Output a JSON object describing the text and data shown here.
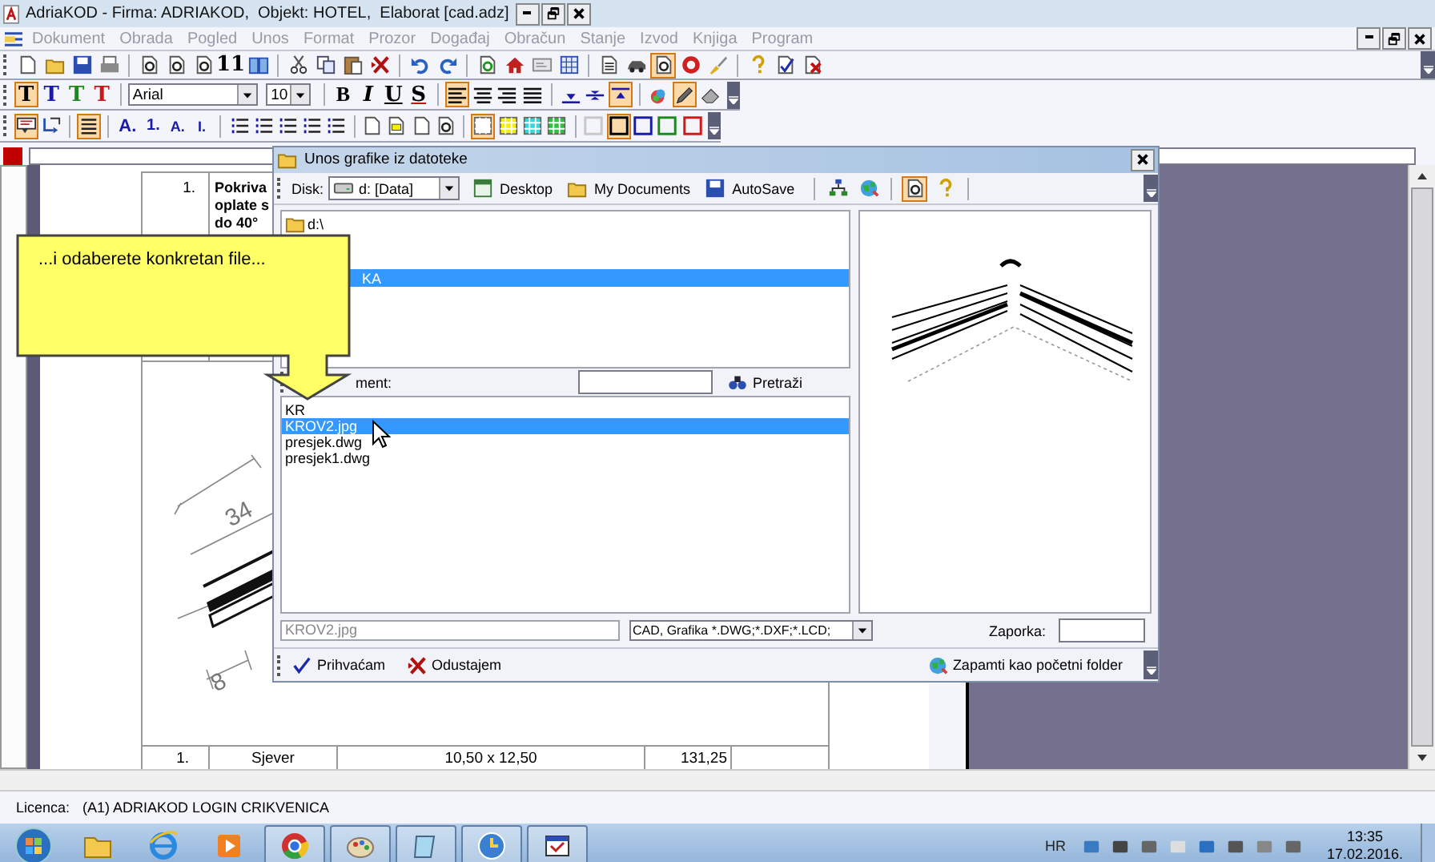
{
  "window": {
    "title": "AdriaKOD - Firma: ADRIAKOD,  Objekt: HOTEL,  Elaborat [cad.adz]"
  },
  "menu": [
    {
      "label": "Dokument",
      "disabled": true
    },
    {
      "label": "Obrada",
      "disabled": true
    },
    {
      "label": "Pogled",
      "disabled": true
    },
    {
      "label": "Unos",
      "disabled": true
    },
    {
      "label": "Format",
      "disabled": true
    },
    {
      "label": "Prozor",
      "disabled": true
    },
    {
      "label": "Događaj",
      "disabled": true
    },
    {
      "label": "Obračun",
      "disabled": true
    },
    {
      "label": "Stanje",
      "disabled": true
    },
    {
      "label": "Izvod",
      "disabled": true
    },
    {
      "label": "Knjiga",
      "disabled": true
    },
    {
      "label": "Program",
      "disabled": true
    }
  ],
  "toolbar_1": [
    [
      {
        "kind": "icon",
        "pressed": false
      },
      {
        "kind": "icon",
        "pressed": false
      },
      {
        "kind": "icon",
        "pressed": false
      },
      {
        "kind": "icon",
        "pressed": false
      }
    ],
    [
      {
        "kind": "icon",
        "pressed": false
      },
      {
        "kind": "icon",
        "pressed": false
      },
      {
        "kind": "icon",
        "pressed": false
      },
      {
        "kind": "text",
        "label": "11",
        "pressed": false
      },
      {
        "kind": "icon",
        "pressed": false
      }
    ],
    [
      {
        "kind": "icon",
        "pressed": false
      },
      {
        "kind": "icon",
        "pressed": false
      },
      {
        "kind": "icon",
        "pressed": false
      },
      {
        "kind": "icon",
        "pressed": false
      }
    ],
    [
      {
        "kind": "icon",
        "pressed": false
      },
      {
        "kind": "icon",
        "pressed": false
      }
    ],
    [
      {
        "kind": "icon",
        "pressed": false
      },
      {
        "kind": "icon",
        "pressed": false
      },
      {
        "kind": "icon",
        "pressed": false
      },
      {
        "kind": "icon",
        "pressed": false
      }
    ],
    [
      {
        "kind": "icon",
        "pressed": false
      },
      {
        "kind": "icon",
        "pressed": false
      },
      {
        "kind": "icon",
        "pressed": true
      },
      {
        "kind": "icon",
        "pressed": false
      },
      {
        "kind": "icon",
        "pressed": false
      }
    ],
    [
      {
        "kind": "icon",
        "pressed": false
      },
      {
        "kind": "icon",
        "pressed": false
      },
      {
        "kind": "icon",
        "pressed": false
      }
    ]
  ],
  "toolbar_2": [
    [
      {
        "kind": "text",
        "label": "T",
        "pressed": true
      },
      {
        "kind": "text",
        "label": "T",
        "color": "#1a1aa8",
        "pressed": false
      },
      {
        "kind": "text",
        "label": "T",
        "color": "#1a8a1a",
        "pressed": false
      },
      {
        "kind": "text",
        "label": "T",
        "color": "#c81818",
        "pressed": false
      }
    ],
    [
      {
        "kind": "select",
        "value": "Arial"
      },
      {
        "kind": "select",
        "value": "10"
      }
    ],
    [
      {
        "kind": "text",
        "label": "B",
        "color": "#000000",
        "pressed": false
      },
      {
        "kind": "text",
        "label": "I",
        "color": "#000000",
        "pressed": false
      },
      {
        "kind": "text",
        "label": "U",
        "color": "#000000",
        "pressed": false
      },
      {
        "kind": "text",
        "label": "S",
        "color": "#000000",
        "pressed": false
      }
    ],
    [
      {
        "kind": "icon",
        "pressed": true
      },
      {
        "kind": "icon",
        "pressed": false
      },
      {
        "kind": "icon",
        "pressed": false
      },
      {
        "kind": "icon",
        "pressed": false
      }
    ],
    [
      {
        "kind": "icon",
        "pressed": false
      },
      {
        "kind": "icon",
        "pressed": false
      },
      {
        "kind": "icon",
        "pressed": true
      }
    ],
    [
      {
        "kind": "icon",
        "pressed": false
      },
      {
        "kind": "icon",
        "pressed": true
      },
      {
        "kind": "icon",
        "pressed": false
      }
    ]
  ],
  "toolbar_3": [
    [
      {
        "kind": "icon",
        "pressed": true
      },
      {
        "kind": "icon",
        "pressed": false
      }
    ],
    [
      {
        "kind": "icon",
        "pressed": true
      }
    ],
    [
      {
        "kind": "text",
        "label": "A.",
        "color": "#1a1aa8",
        "pressed": false
      },
      {
        "kind": "text",
        "label": "1.",
        "color": "#1a1aa8",
        "pressed": false
      },
      {
        "kind": "text",
        "label": "A.",
        "color": "#1a1aa8",
        "pressed": false
      },
      {
        "kind": "text",
        "label": "I.",
        "color": "#1a1aa8",
        "pressed": false
      }
    ],
    [
      {
        "kind": "icon",
        "pressed": false
      },
      {
        "kind": "icon",
        "pressed": false
      },
      {
        "kind": "icon",
        "pressed": false
      },
      {
        "kind": "icon",
        "pressed": false
      },
      {
        "kind": "icon",
        "pressed": false
      }
    ],
    [
      {
        "kind": "icon",
        "pressed": false
      },
      {
        "kind": "icon",
        "pressed": false
      },
      {
        "kind": "icon",
        "pressed": false
      },
      {
        "kind": "icon",
        "pressed": false
      }
    ],
    [
      {
        "kind": "grid",
        "color": "#ffffff",
        "pressed": true
      },
      {
        "kind": "grid",
        "color": "#f5f000",
        "pressed": false
      },
      {
        "kind": "grid",
        "color": "#30d8e0",
        "pressed": false
      },
      {
        "kind": "grid",
        "color": "#30c040",
        "pressed": false
      }
    ],
    [
      {
        "kind": "swatch",
        "color": "#c8c8c8",
        "pressed": false
      },
      {
        "kind": "swatch",
        "color": "#000000",
        "pressed": true
      },
      {
        "kind": "swatch",
        "color": "#1a1aa8",
        "pressed": false
      },
      {
        "kind": "swatch",
        "color": "#1a8a1a",
        "pressed": false
      },
      {
        "kind": "swatch",
        "color": "#d01818",
        "pressed": false
      }
    ]
  ],
  "document": {
    "number": "1.",
    "description": [
      "Pokriva",
      "oplate s",
      "do 40°"
    ],
    "drawing_labels": [
      "34",
      "8"
    ],
    "summary_row": [
      "1.",
      "Sjever",
      "10,50 x 12,50",
      "131,25"
    ]
  },
  "dialog": {
    "title": "Unos grafike iz datoteke",
    "disk_label": "Disk:",
    "disk_value": "d: [Data]",
    "links": [
      {
        "label": "Desktop"
      },
      {
        "label": "My Documents"
      },
      {
        "label": "AutoSave"
      }
    ],
    "tools": [
      {
        "pressed": false
      },
      {
        "pressed": false
      },
      {
        "pressed": true
      },
      {
        "pressed": false
      }
    ],
    "folders": [
      {
        "name": "d:\\",
        "selected": false,
        "children": [
          {
            "name": "KA",
            "selected": true
          }
        ]
      }
    ],
    "search_label": "ment:",
    "search_button": "Pretraži",
    "files": [
      {
        "name": "KR",
        "selected": false
      },
      {
        "name": "KROV2.jpg",
        "selected": true
      },
      {
        "name": "presjek.dwg",
        "selected": false
      },
      {
        "name": "presjek1.dwg",
        "selected": false
      }
    ],
    "filename": "KROV2.jpg",
    "filter": "CAD, Grafika *.DWG;*.DXF;*.LCD;",
    "password_label": "Zaporka:",
    "buttons": [
      {
        "label": "Prihvaćam"
      },
      {
        "label": "Odustajem"
      },
      {
        "label": "Zapamti kao početni folder"
      }
    ]
  },
  "callout": {
    "text": "...i odaberete konkretan file..."
  },
  "status_bar": {
    "label": "Licenca:",
    "value": "(A1) ADRIAKOD LOGIN CRIKVENICA"
  },
  "taskbar": {
    "apps": [
      {
        "running": false
      },
      {
        "running": false
      },
      {
        "running": false
      },
      {
        "running": true
      },
      {
        "running": true
      },
      {
        "running": true
      },
      {
        "running": true
      },
      {
        "running": true
      }
    ],
    "language": "HR",
    "time": "13:35",
    "date": "17.02.2016."
  }
}
